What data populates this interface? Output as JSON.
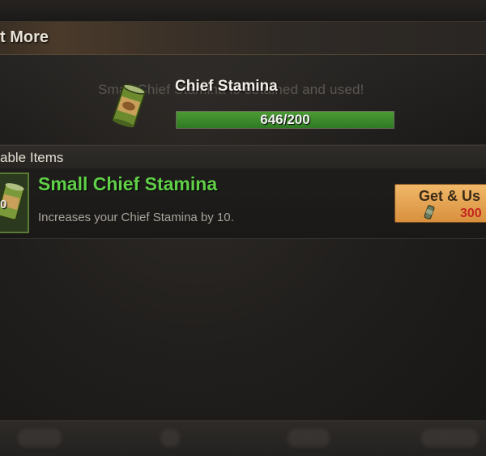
{
  "header": {
    "title": "t More"
  },
  "stamina": {
    "ghost_text": "Small Chief Stamina is obtained and used!",
    "title": "Chief Stamina",
    "progress_label": "646/200",
    "progress_fraction": 1.0
  },
  "section": {
    "title": "able Items"
  },
  "item": {
    "count": "0",
    "name": "Small Chief Stamina",
    "description": "Increases your Chief Stamina by 10.",
    "button_label": "Get & Us",
    "cost": "300",
    "icon": "stamina-can-icon",
    "cost_icon": "currency-can-icon"
  },
  "colors": {
    "item_name": "#5fd047",
    "progress_fill": "#3f8c2e",
    "button": "#e8a552",
    "cost": "#c4261e"
  }
}
